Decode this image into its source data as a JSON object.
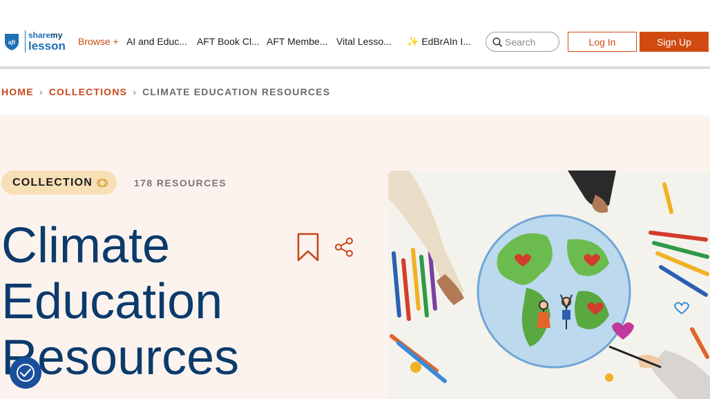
{
  "page": {
    "dot": "."
  },
  "header": {
    "logo": {
      "line1_a": "share",
      "line1_b": "my",
      "line2": "lesson",
      "shield_text": "aft"
    },
    "nav": [
      {
        "label": "Browse +"
      },
      {
        "label": "AI and Educ..."
      },
      {
        "label": "AFT Book Cl..."
      },
      {
        "label": "AFT Membe..."
      },
      {
        "label": "Vital Lesso..."
      },
      {
        "label": "✨ EdBrAIn I..."
      }
    ],
    "search": {
      "placeholder": "Search"
    },
    "login_label": "Log In",
    "signup_label": "Sign Up"
  },
  "breadcrumb": {
    "home": "HOME",
    "collections": "COLLECTIONS",
    "current": "CLIMATE EDUCATION RESOURCES",
    "separator": "›"
  },
  "collection": {
    "badge": "COLLECTION",
    "count": "178 RESOURCES",
    "title": "Climate Education Resources"
  },
  "colors": {
    "brand_orange": "#d04b12",
    "title_navy": "#0b3b6c",
    "hero_bg": "#fdf3ee",
    "badge_bg": "#f7dfb6"
  },
  "icons": {
    "search": "search-icon",
    "bookmark": "bookmark-icon",
    "share": "share-icon",
    "accessibility": "accessibility-icon",
    "collection": "collection-rings-icon"
  }
}
